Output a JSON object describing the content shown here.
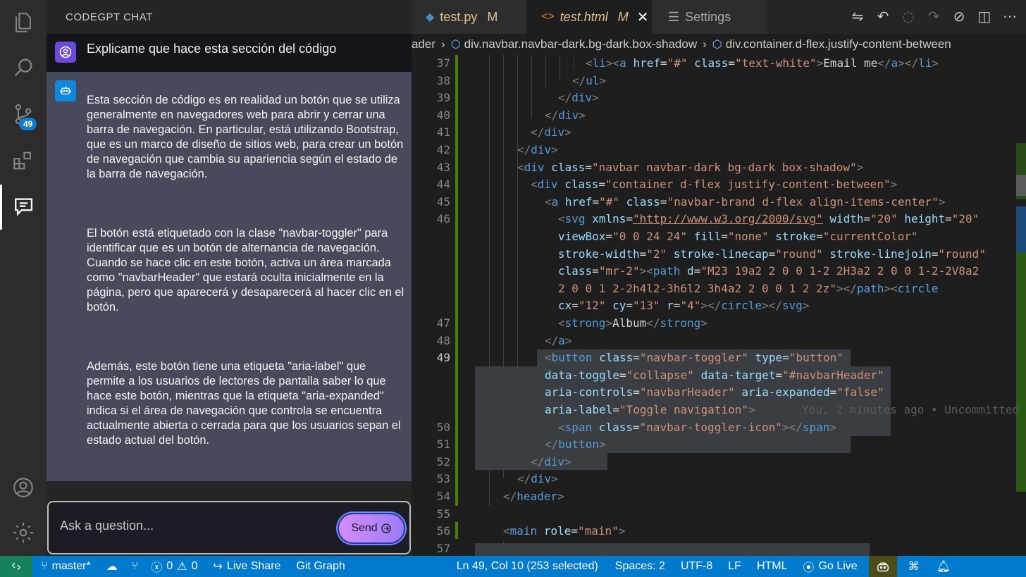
{
  "chat": {
    "header": "CODEGPT CHAT",
    "user_message": "Explicame que hace esta sección del código",
    "bot_paragraphs": [
      "Esta sección de código es en realidad un botón que se utiliza generalmente en navegadores web para abrir y cerrar una barra de navegación. En particular, está utilizando Bootstrap, que es un marco de diseño de sitios web, para crear un botón de navegación que cambia su apariencia según el estado de la barra de navegación.",
      "El botón está etiquetado con la clase \"navbar-toggler\" para identificar que es un botón de alternancia de navegación. Cuando se hace clic en este botón, activa un área marcada como \"navbarHeader\" que estará oculta inicialmente en la página, pero que aparecerá y desaparecerá al hacer clic en el botón.",
      "Además, este botón tiene una etiqueta \"aria-label\" que permite a los usuarios de lectores de pantalla saber lo que hace este botón, mientras que la etiqueta \"aria-expanded\" indica si el área de navegación que controla se encuentra actualmente abierta o cerrada para que los usuarios sepan el estado actual del botón."
    ],
    "input_placeholder": "Ask a question...",
    "send_label": "Send"
  },
  "activity": {
    "scm_badge": "49"
  },
  "tabs": [
    {
      "label": "test.py",
      "status": "M"
    },
    {
      "label": "test.html",
      "status": "M"
    },
    {
      "label": "Settings"
    }
  ],
  "breadcrumb": [
    "ader",
    "div.navbar.navbar-dark.bg-dark.box-shadow",
    "div.container.d-flex.justify-content-between"
  ],
  "editor": {
    "blame": "You, 2 minutes ago • Uncommitted"
  },
  "statusbar": {
    "branch": "master*",
    "errors": "0",
    "warnings": "0",
    "live_share": "Live Share",
    "git_graph": "Git Graph",
    "cursor": "Ln 49, Col 10 (253 selected)",
    "spaces": "Spaces: 2",
    "encoding": "UTF-8",
    "eol": "LF",
    "language": "HTML",
    "go_live": "Go Live"
  },
  "colors": {
    "accent": "#007acc",
    "tag": "#569cd6",
    "attr": "#9cdcfe",
    "string": "#ce9178",
    "modified": "#e2c08d"
  }
}
